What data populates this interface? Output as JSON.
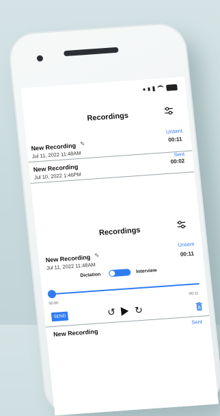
{
  "screen1": {
    "title": "Recordings",
    "rows": [
      {
        "title": "New Recording",
        "date": "Jul 11, 2022 11:48AM",
        "status": "Unsent",
        "duration": "00:11"
      },
      {
        "title": "New Recording",
        "date": "Jul 10, 2022 1:46PM",
        "status": "Sent",
        "duration": "00:02"
      }
    ]
  },
  "screen2": {
    "title": "Recordings",
    "row": {
      "title": "New Recording",
      "date": "Jul 11, 2022 11:48AM",
      "status": "Unsent",
      "duration": "00:11"
    },
    "toggle_left": "Dictation",
    "toggle_right": "Interview",
    "time_start": "00:00",
    "time_end": "-00:11",
    "send_label": "SEND",
    "next_row": {
      "title": "New Recording",
      "status": "Sent"
    }
  },
  "icons": {
    "filter": "sliders-icon",
    "edit": "pencil-icon",
    "rewind": "rewind-icon",
    "play": "play-icon",
    "forward": "forward-icon",
    "delete": "trash-icon"
  },
  "colors": {
    "accent": "#2f7cf0",
    "background": "#c9dadd"
  },
  "toggle_level": 1.0,
  "playback_progress": 0.0
}
